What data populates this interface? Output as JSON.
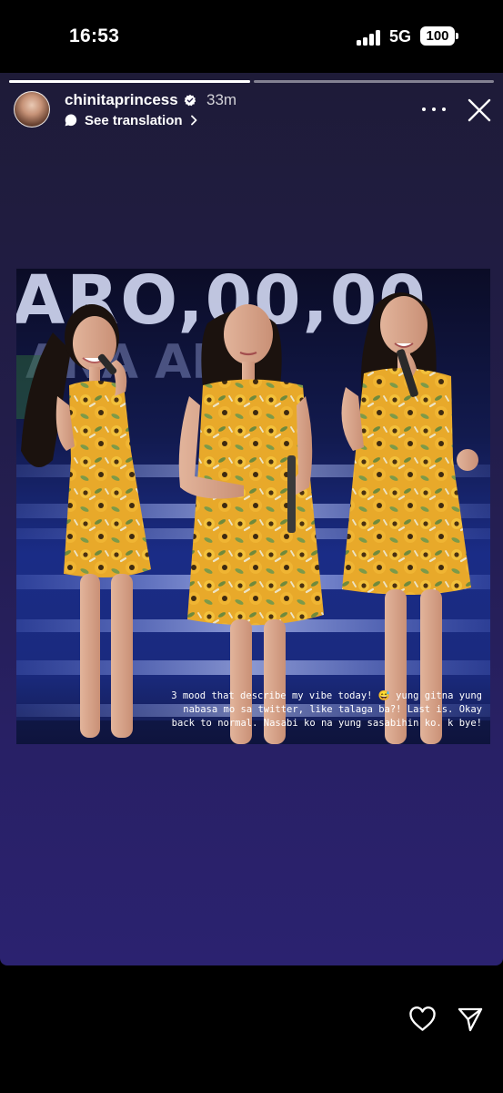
{
  "status_bar": {
    "time": "16:53",
    "network": "5G",
    "battery": "100"
  },
  "story": {
    "progress": [
      1.0,
      0.0
    ],
    "username": "chinitaprincess",
    "verified": true,
    "time_ago": "33m",
    "translation_label": "See translation",
    "caption": "3 mood that describe my vibe today! 😅 yung gitna yung\nnabasa mo sa twitter, like talaga ba?! Last is. Okay\nback to normal. Nasabi ko na yung sasabihin ko. k bye!",
    "photo_backdrop_text": "ARO,00,00",
    "colors": {
      "background_top": "#1e1b38",
      "background_bottom": "#2b2270",
      "stage_blue": "#1a2c86",
      "dress_yellow": "#e8a92a"
    }
  },
  "icons": {
    "verified": "verified-badge-icon",
    "translate": "translate-bubble-icon",
    "more": "more-options-icon",
    "close": "close-icon",
    "like": "heart-icon",
    "share": "send-icon"
  }
}
